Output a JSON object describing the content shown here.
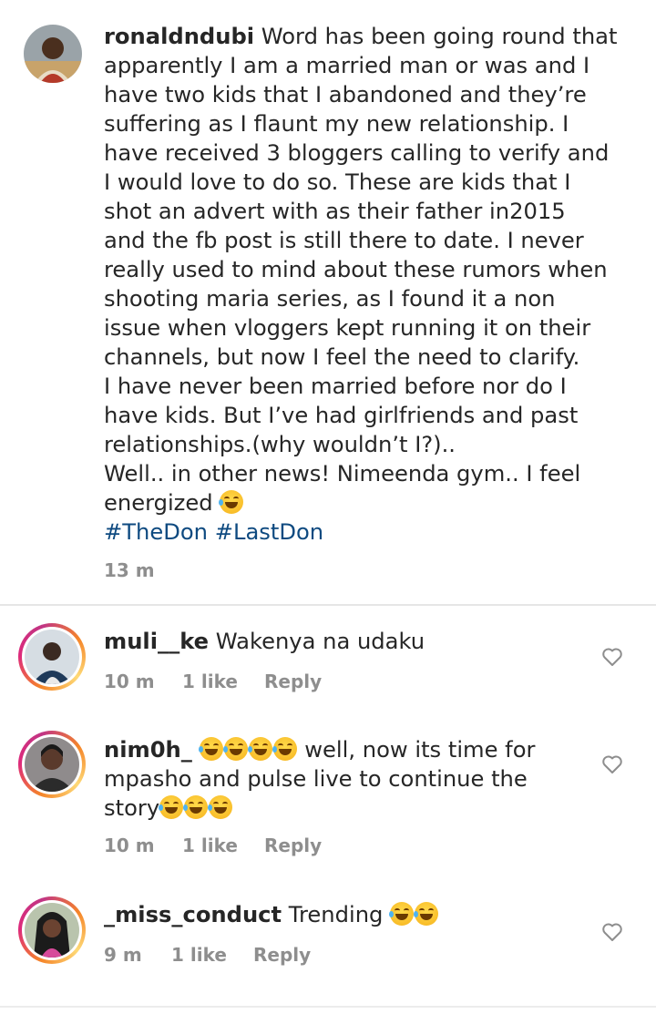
{
  "post": {
    "username": "ronaldndubi",
    "lines": [
      "Word has been going round that",
      "apparently I am a married man or was and I",
      "have two kids that I abandoned and they’re",
      "suffering as I flaunt my new relationship. I",
      "have received 3 bloggers calling to verify and",
      "I would love to do so. These are kids that I",
      "shot an advert with as their father in2015",
      "and the fb post is still there to date. I never",
      "really used to mind about these rumors when",
      "shooting maria series, as I found it a non",
      "issue when vloggers kept running it on their",
      "channels, but now I feel the need to clarify.",
      "I have never been married before nor do I",
      "have kids. But I’ve had girlfriends and past",
      "relationships.(why wouldn’t I?)..",
      "Well.. in other news! Nimeenda gym.. I feel",
      "energized"
    ],
    "hashtag1": "#TheDon",
    "hashtag2": "#LastDon",
    "time": "13 m"
  },
  "comments": [
    {
      "username": "muli__ke",
      "text": "Wakenya na udaku",
      "time": "10 m",
      "likes": "1 like",
      "reply": "Reply"
    },
    {
      "username": "nim0h_",
      "text1": "well, now its time for",
      "text2": "mpasho and pulse live to continue the",
      "text3": "story",
      "time": "10 m",
      "likes": "1 like",
      "reply": "Reply"
    },
    {
      "username": "_miss_conduct",
      "text": "Trending",
      "time": "9 m",
      "likes": "1 like",
      "reply": "Reply"
    }
  ],
  "icons": {
    "heart": "heart-outline-icon",
    "emoji": "tears-of-joy-emoji"
  },
  "colors": {
    "hashtag": "#0e4a80",
    "meta": "#8e8e8e",
    "ring": "#dd2a7b"
  }
}
